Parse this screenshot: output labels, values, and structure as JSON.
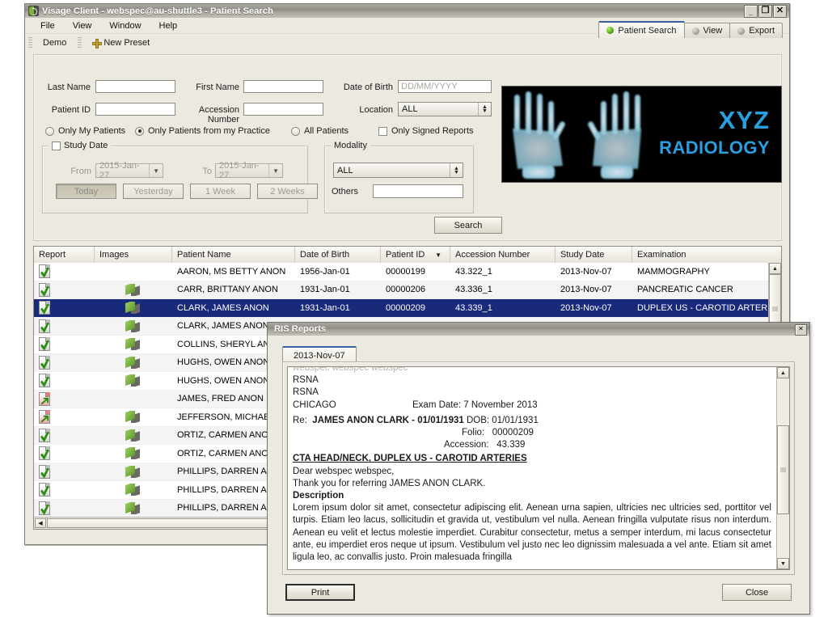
{
  "main_window": {
    "title": "Visage Client - webspec@au-shuttle3 - Patient Search",
    "icon": "visage-logo-icon",
    "window_buttons": {
      "minimize": "_",
      "maximize": "❐",
      "close": "✕"
    },
    "menu": [
      "File",
      "View",
      "Window",
      "Help"
    ],
    "toolbar": {
      "preset_label": "Demo",
      "new_preset_label": "New Preset",
      "new_preset_icon": "plus-icon"
    },
    "tabs": [
      {
        "label": "Patient Search",
        "active": true,
        "led": "green"
      },
      {
        "label": "View",
        "active": false,
        "led": "grey"
      },
      {
        "label": "Export",
        "active": false,
        "led": "grey"
      }
    ]
  },
  "search_form": {
    "last_name": {
      "label": "Last Name",
      "value": "",
      "placeholder": ""
    },
    "first_name": {
      "label": "First Name",
      "value": "",
      "placeholder": ""
    },
    "date_of_birth": {
      "label": "Date of Birth",
      "value": "",
      "placeholder": "DD/MM/YYYY"
    },
    "patient_id": {
      "label": "Patient ID",
      "value": "",
      "placeholder": ""
    },
    "accession_number": {
      "label": "Accession Number",
      "value": "",
      "placeholder": ""
    },
    "location": {
      "label": "Location",
      "value": "ALL"
    },
    "scope_options": [
      {
        "label": "Only My Patients",
        "selected": false
      },
      {
        "label": "Only Patients from my Practice",
        "selected": true
      },
      {
        "label": "All Patients",
        "selected": false
      }
    ],
    "only_signed_reports": {
      "label": "Only Signed Reports",
      "checked": false
    },
    "study_date": {
      "title": "Study Date",
      "enabled": false,
      "from_label": "From",
      "from_value": "2015-Jan-27",
      "to_label": "To",
      "to_value": "2015-Jan-27",
      "quick_buttons": [
        "Today",
        "Yesterday",
        "1 Week",
        "2 Weeks"
      ]
    },
    "modality": {
      "title": "Modality",
      "value": "ALL",
      "others_label": "Others",
      "others_value": ""
    },
    "search_button": "Search"
  },
  "banner": {
    "line1": "XYZ",
    "line2": "RADIOLOGY",
    "image": "hand-xray-image"
  },
  "results_table": {
    "columns": [
      "Report",
      "Images",
      "Patient Name",
      "Date of Birth",
      "Patient ID",
      "Accession Number",
      "Study Date",
      "Examination"
    ],
    "sorted_column": "Patient ID",
    "sort_direction": "desc",
    "rows": [
      {
        "report": "green",
        "images": false,
        "name": "AARON, MS BETTY ANON",
        "dob": "1956-Jan-01",
        "pid": "00000199",
        "acc": "43.322_1",
        "study": "2013-Nov-07",
        "exam": "MAMMOGRAPHY",
        "selected": false
      },
      {
        "report": "green",
        "images": true,
        "name": "CARR, BRITTANY ANON",
        "dob": "1931-Jan-01",
        "pid": "00000206",
        "acc": "43.336_1",
        "study": "2013-Nov-07",
        "exam": "PANCREATIC CANCER",
        "selected": false
      },
      {
        "report": "green",
        "images": true,
        "name": "CLARK, JAMES ANON",
        "dob": "1931-Jan-01",
        "pid": "00000209",
        "acc": "43.339_1",
        "study": "2013-Nov-07",
        "exam": "DUPLEX US - CAROTID ARTERIES",
        "selected": true
      },
      {
        "report": "green",
        "images": true,
        "name": "CLARK, JAMES ANON",
        "dob": "",
        "pid": "",
        "acc": "",
        "study": "",
        "exam": "",
        "selected": false
      },
      {
        "report": "green",
        "images": true,
        "name": "COLLINS, SHERYL ANON",
        "dob": "",
        "pid": "",
        "acc": "",
        "study": "",
        "exam": "",
        "selected": false
      },
      {
        "report": "green",
        "images": true,
        "name": "HUGHS, OWEN ANON",
        "dob": "",
        "pid": "",
        "acc": "",
        "study": "",
        "exam": "",
        "selected": false
      },
      {
        "report": "green",
        "images": true,
        "name": "HUGHS, OWEN ANON",
        "dob": "",
        "pid": "",
        "acc": "",
        "study": "",
        "exam": "",
        "selected": false
      },
      {
        "report": "red",
        "images": false,
        "name": "JAMES, FRED ANON",
        "dob": "",
        "pid": "",
        "acc": "",
        "study": "",
        "exam": "",
        "selected": false
      },
      {
        "report": "red",
        "images": true,
        "name": "JEFFERSON, MICHAEL ANON",
        "dob": "",
        "pid": "",
        "acc": "",
        "study": "",
        "exam": "",
        "selected": false
      },
      {
        "report": "green",
        "images": true,
        "name": "ORTIZ, CARMEN ANON",
        "dob": "",
        "pid": "",
        "acc": "",
        "study": "",
        "exam": "",
        "selected": false
      },
      {
        "report": "green",
        "images": true,
        "name": "ORTIZ, CARMEN ANON",
        "dob": "",
        "pid": "",
        "acc": "",
        "study": "",
        "exam": "",
        "selected": false
      },
      {
        "report": "green",
        "images": true,
        "name": "PHILLIPS, DARREN ANON",
        "dob": "",
        "pid": "",
        "acc": "",
        "study": "",
        "exam": "",
        "selected": false
      },
      {
        "report": "green",
        "images": true,
        "name": "PHILLIPS, DARREN ANON",
        "dob": "",
        "pid": "",
        "acc": "",
        "study": "",
        "exam": "",
        "selected": false
      },
      {
        "report": "green",
        "images": true,
        "name": "PHILLIPS, DARREN ANON",
        "dob": "",
        "pid": "",
        "acc": "",
        "study": "",
        "exam": "",
        "selected": false
      }
    ]
  },
  "ris_dialog": {
    "title": "RIS Reports",
    "close_icon": "✕",
    "tab": "2013-Nov-07",
    "report": {
      "clipped_line": "webspec webspec webspec",
      "org1": "RSNA",
      "org2": "RSNA",
      "city": "CHICAGO",
      "exam_date_label": "Exam Date:",
      "exam_date_value": "7 November 2013",
      "re_label": "Re:",
      "re_patient": "JAMES ANON CLARK - 01/01/1931",
      "dob_label": "DOB:",
      "dob_value": "01/01/1931",
      "folio_label": "Folio:",
      "folio_value": "00000209",
      "accession_label": "Accession:",
      "accession_value": "43.339",
      "exam_title": "CTA HEAD/NECK, DUPLEX US - CAROTID ARTERIES",
      "salutation": "Dear webspec webspec,",
      "referral": "Thank you for referring JAMES ANON CLARK.",
      "description_heading": "Description",
      "description_body": "Lorem ipsum dolor sit amet, consectetur adipiscing elit. Aenean urna sapien, ultricies nec ultricies sed, porttitor vel turpis. Etiam leo lacus, sollicitudin et gravida ut, vestibulum vel nulla. Aenean fringilla vulputate risus non interdum. Aenean eu velit et lectus molestie imperdiet. Curabitur consectetur, metus a semper interdum, mi lacus consectetur ante, eu imperdiet eros neque ut ipsum. Vestibulum vel justo nec leo dignissim malesuada a vel ante. Etiam sit amet ligula leo, ac convallis justo. Proin malesuada fringilla"
    },
    "print_button": "Print",
    "close_button": "Close"
  },
  "colors": {
    "window_chrome": "#ece9e0",
    "selection_blue": "#1a2a7a",
    "accent_tab_blue": "#3a5f9e",
    "brand_blue": "#2a9fe0",
    "status_green": "#4fa914"
  }
}
